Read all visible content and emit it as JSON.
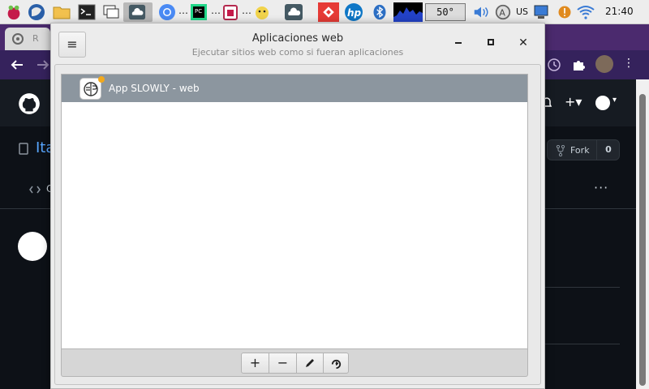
{
  "taskbar": {
    "ellipsis": "…",
    "temperature": "50°",
    "language": "US",
    "clock": "21:40"
  },
  "browser": {
    "tab_label": "R",
    "repo_title": "Ita",
    "code_tab_partial": "C",
    "fork_label": "Fork",
    "fork_count": "0",
    "more_dots": "···",
    "window_controls": {
      "minimize": "–",
      "restore": "⧉",
      "close": "✕"
    }
  },
  "dialog": {
    "title": "Aplicaciones web",
    "subtitle": "Ejecutar sitios web como si fueran aplicaciones",
    "menu_glyph": "≡",
    "close_glyph": "✕",
    "apps": [
      {
        "name": "App SLOWLY - web"
      }
    ],
    "toolbar": {
      "add": "+",
      "remove": "−",
      "edit": "✎",
      "run": "↻"
    }
  },
  "colors": {
    "selected_row": "#8c969f",
    "github_bg": "#0d1117",
    "browser_purple": "#4b2a6e",
    "link_blue": "#58a6ff"
  }
}
